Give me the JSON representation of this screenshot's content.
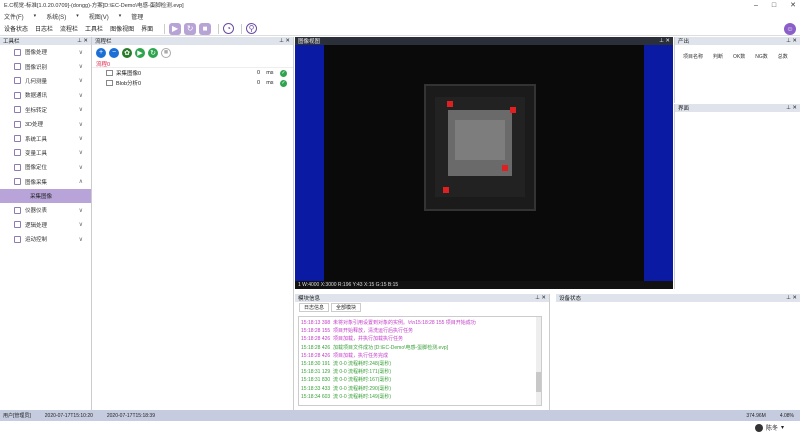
{
  "window": {
    "title": "E.C视觉-标准[1.0.20.0709]-(dongg)-方案[D:\\EC-Demo\\电感-蛋脚检测.evp]"
  },
  "menu": [
    "文件(F)",
    "系统(S)",
    "视图(V)",
    "管理"
  ],
  "toolbar": {
    "labels": [
      "设备状态",
      "日志栏",
      "流程栏",
      "工具栏",
      "图像视图",
      "界面"
    ]
  },
  "tools_panel": {
    "title": "工具栏",
    "items": [
      {
        "label": "图像处理",
        "icon": "image-process-icon"
      },
      {
        "label": "图像识别",
        "icon": "image-recognize-icon"
      },
      {
        "label": "几何测量",
        "icon": "geometry-icon"
      },
      {
        "label": "数据通讯",
        "icon": "comm-icon"
      },
      {
        "label": "坐标转定",
        "icon": "coordinate-icon"
      },
      {
        "label": "3D处理",
        "icon": "3d-icon"
      },
      {
        "label": "系统工具",
        "icon": "system-tools-icon"
      },
      {
        "label": "变量工具",
        "icon": "variable-icon"
      },
      {
        "label": "图像定位",
        "icon": "locate-icon"
      },
      {
        "label": "图像采集",
        "icon": "capture-icon"
      },
      {
        "label": "采集图像",
        "icon": "",
        "selected": true
      },
      {
        "label": "仪器仪表",
        "icon": "instrument-icon"
      },
      {
        "label": "逻辑处理",
        "icon": "logic-icon"
      },
      {
        "label": "运动控制",
        "icon": "motion-icon"
      }
    ]
  },
  "process_panel": {
    "title": "流程栏",
    "tab": "流程0",
    "rows": [
      {
        "name": "采集图像0",
        "time": "0",
        "unit": "ms"
      },
      {
        "name": "Blob分析0",
        "time": "0",
        "unit": "ms"
      }
    ]
  },
  "image_view": {
    "title": "图像视图",
    "status": "1   W:4000  X:3000   R:196  Y:43    X:15   G:15   B:15"
  },
  "result_panel": {
    "title": "产出",
    "columns": [
      "项目名称",
      "判断",
      "OK数",
      "NG数",
      "总数"
    ]
  },
  "interface_panel": {
    "title": "界面"
  },
  "log_panel": {
    "title": "模块信息",
    "tabs": [
      "日志信息",
      "全部模块"
    ],
    "lines": [
      {
        "t": "15:18:13 398",
        "msg": "未将对象引用设置到对象的实例。\\r\\n15:18:28 155   项目开始成功",
        "c": "m"
      },
      {
        "t": "15:18:28 155",
        "msg": "项目开始释放，清洗运行后执行任务",
        "c": "m"
      },
      {
        "t": "15:18:28 426",
        "msg": "项目加载，并执行加载执行任务",
        "c": "m"
      },
      {
        "t": "15:18:28 426",
        "msg": "加载项目文件成功 [D:\\EC-Demo\\电感-蛋脚检测.evp]",
        "c": "g"
      },
      {
        "t": "15:18:28 426",
        "msg": "项目加载，执行任务完成",
        "c": "m"
      },
      {
        "t": "15:18:30 191",
        "msg": "流 0-0  流程耗时:248(毫秒)",
        "c": "g"
      },
      {
        "t": "15:18:31 129",
        "msg": "流 0-0  流程耗时:171(毫秒)",
        "c": "g"
      },
      {
        "t": "15:18:31 830",
        "msg": "流 0-0  流程耗时:167(毫秒)",
        "c": "g"
      },
      {
        "t": "15:18:33 433",
        "msg": "流 0-0  流程耗时:290(毫秒)",
        "c": "g"
      },
      {
        "t": "15:18:34 603",
        "msg": "流 0-0  流程耗时:149(毫秒)",
        "c": "g"
      }
    ]
  },
  "device_panel": {
    "title": "设备状态"
  },
  "statusbar": {
    "user": "用户[管理员]",
    "time1": "2020-07-17T15:10:20",
    "time2": "2020-07-17T15:18:39",
    "mem": "374.96M",
    "cpu": "4.08%"
  },
  "account": "陈冬"
}
